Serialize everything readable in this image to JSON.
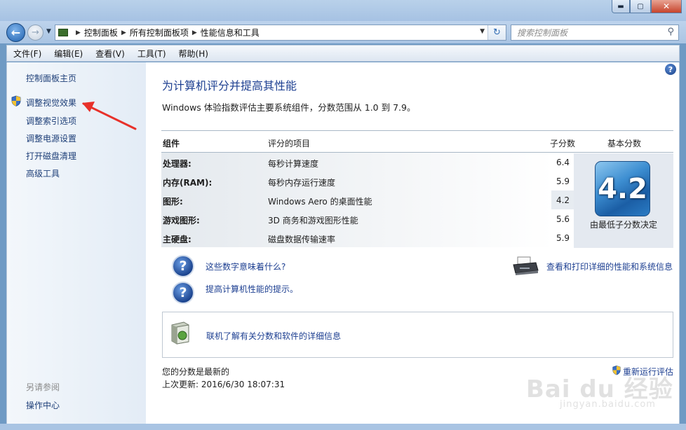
{
  "window": {
    "controls": {
      "minimize": "▬",
      "maximize": "▢",
      "close": "✕"
    }
  },
  "nav": {
    "back_icon": "back-arrow-icon",
    "forward_icon": "forward-arrow-icon",
    "breadcrumbs": [
      "控制面板",
      "所有控制面板项",
      "性能信息和工具"
    ],
    "search_placeholder": "搜索控制面板"
  },
  "menubar": {
    "items": [
      "文件(F)",
      "编辑(E)",
      "查看(V)",
      "工具(T)",
      "帮助(H)"
    ]
  },
  "sidebar": {
    "items": [
      {
        "label": "控制面板主页"
      },
      {
        "label": "调整视觉效果",
        "icon": "uac-shield-icon"
      },
      {
        "label": "调整索引选项"
      },
      {
        "label": "调整电源设置"
      },
      {
        "label": "打开磁盘清理"
      },
      {
        "label": "高级工具"
      }
    ],
    "see_also": "另请参阅",
    "see_also_items": [
      {
        "label": "操作中心"
      }
    ]
  },
  "main": {
    "title": "为计算机评分并提高其性能",
    "description": "Windows 体验指数评估主要系统组件，分数范围从 1.0 到 7.9。",
    "table": {
      "headers": {
        "component": "组件",
        "rated_item": "评分的项目",
        "subscore": "子分数",
        "base_score": "基本分数"
      },
      "rows": [
        {
          "component": "处理器:",
          "item": "每秒计算速度",
          "score": "6.4"
        },
        {
          "component": "内存(RAM):",
          "item": "每秒内存运行速度",
          "score": "5.9"
        },
        {
          "component": "图形:",
          "item": "Windows Aero 的桌面性能",
          "score": "4.2"
        },
        {
          "component": "游戏图形:",
          "item": "3D 商务和游戏图形性能",
          "score": "5.6"
        },
        {
          "component": "主硬盘:",
          "item": "磁盘数据传输速率",
          "score": "5.9"
        }
      ],
      "base_score": "4.2",
      "base_score_note": "由最低子分数决定"
    },
    "links": {
      "what_numbers_mean": "这些数字意味着什么?",
      "tips": "提高计算机性能的提示。",
      "print_details": "查看和打印详细的性能和系统信息",
      "online_info": "联机了解有关分数和软件的详细信息"
    },
    "status": {
      "current": "您的分数是最新的",
      "last_update": "上次更新: 2016/6/30 18:07:31",
      "rerun": "重新运行评估"
    }
  },
  "watermark": {
    "main": "Bai du 经验",
    "sub": "jingyan.baidu.com"
  },
  "colors": {
    "link": "#1d3f91",
    "title": "#1d3f91",
    "annotation_arrow": "#e8312a",
    "badge": "#2a7bc4"
  }
}
